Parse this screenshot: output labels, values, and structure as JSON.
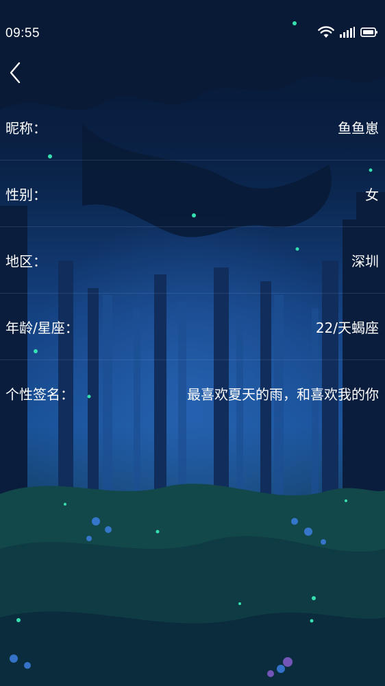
{
  "status_bar": {
    "time": "09:55",
    "icons": [
      "wifi-icon",
      "signal-icon",
      "battery-icon"
    ]
  },
  "nav": {
    "back_icon": "chevron-left-icon"
  },
  "profile": {
    "rows": [
      {
        "label": "昵称：",
        "value": "鱼鱼崽"
      },
      {
        "label": "性别：",
        "value": "女"
      },
      {
        "label": "地区：",
        "value": "深圳"
      },
      {
        "label": "年龄/星座：",
        "value": "22/天蝎座"
      },
      {
        "label": "个性签名：",
        "value": "最喜欢夏天的雨，和喜欢我的你"
      }
    ]
  },
  "colors": {
    "sky_dark": "#071a36",
    "forest_blue": "#1b4d95",
    "ground_green": "#134a4a",
    "firefly": "#2fd6a8"
  }
}
